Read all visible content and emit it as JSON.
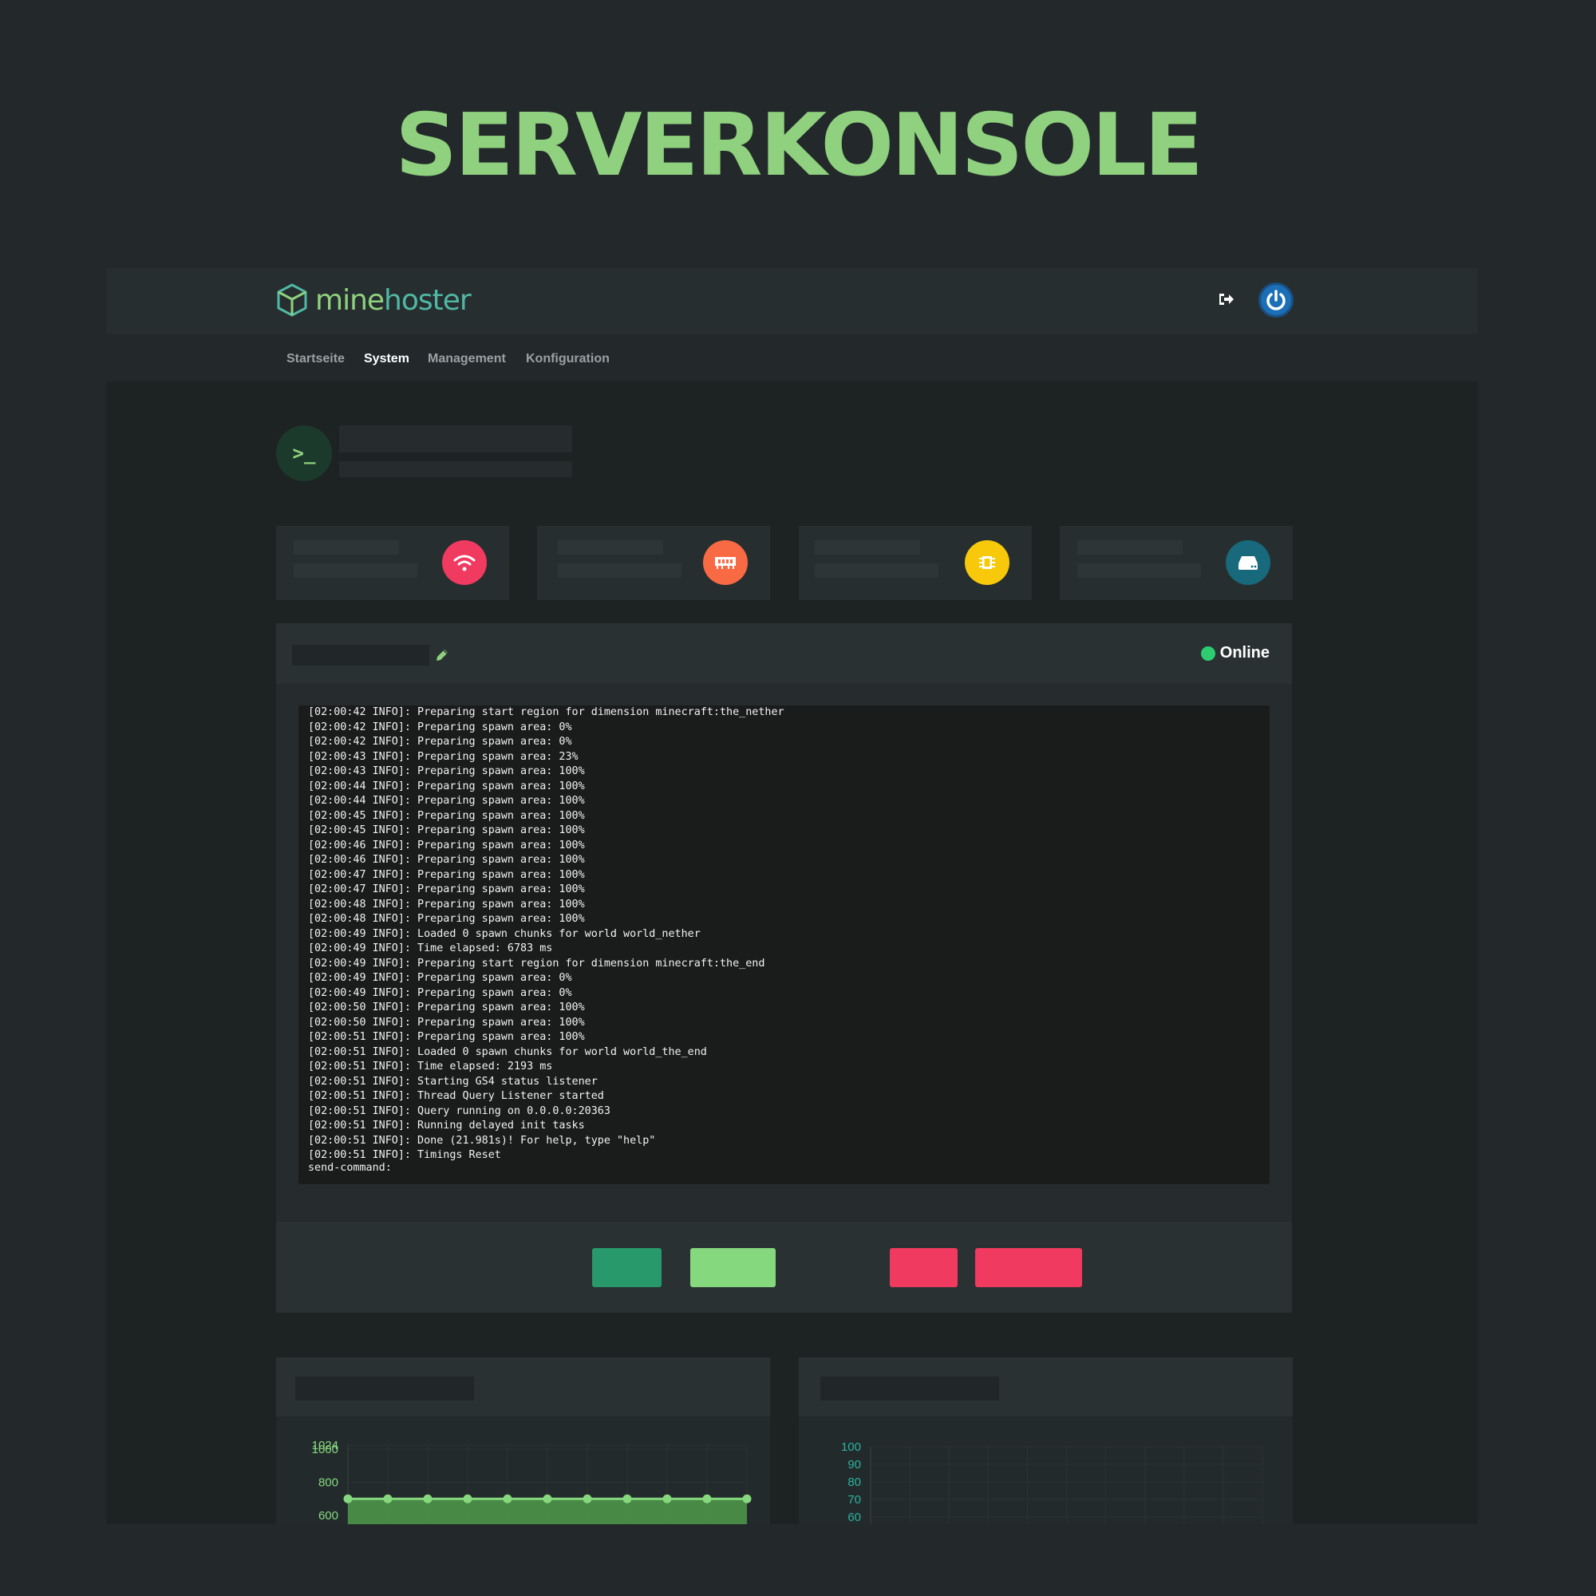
{
  "headline": "SERVERKONSOLE",
  "brand": {
    "part1": "mine",
    "part2": "hoster"
  },
  "header": {
    "logout_icon": "sign-out-icon",
    "power_icon": "power-icon"
  },
  "nav": [
    {
      "label": "Startseite",
      "active": false
    },
    {
      "label": "System",
      "active": true
    },
    {
      "label": "Management",
      "active": false
    },
    {
      "label": "Konfiguration",
      "active": false
    }
  ],
  "stats": [
    {
      "icon": "wifi-icon",
      "color": "#f03a5f"
    },
    {
      "icon": "memory-icon",
      "color": "#f86a43"
    },
    {
      "icon": "cpu-icon",
      "color": "#f7c90a"
    },
    {
      "icon": "hdd-icon",
      "color": "#17697b"
    }
  ],
  "console": {
    "status": "Online",
    "prompt": "send-command:",
    "lines": [
      "[02:00:42 INFO]: Preparing start region for dimension minecraft:the_nether",
      "[02:00:42 INFO]: Preparing spawn area: 0%",
      "[02:00:42 INFO]: Preparing spawn area: 0%",
      "[02:00:43 INFO]: Preparing spawn area: 23%",
      "[02:00:43 INFO]: Preparing spawn area: 100%",
      "[02:00:44 INFO]: Preparing spawn area: 100%",
      "[02:00:44 INFO]: Preparing spawn area: 100%",
      "[02:00:45 INFO]: Preparing spawn area: 100%",
      "[02:00:45 INFO]: Preparing spawn area: 100%",
      "[02:00:46 INFO]: Preparing spawn area: 100%",
      "[02:00:46 INFO]: Preparing spawn area: 100%",
      "[02:00:47 INFO]: Preparing spawn area: 100%",
      "[02:00:47 INFO]: Preparing spawn area: 100%",
      "[02:00:48 INFO]: Preparing spawn area: 100%",
      "[02:00:48 INFO]: Preparing spawn area: 100%",
      "[02:00:49 INFO]: Loaded 0 spawn chunks for world world_nether",
      "[02:00:49 INFO]: Time elapsed: 6783 ms",
      "[02:00:49 INFO]: Preparing start region for dimension minecraft:the_end",
      "[02:00:49 INFO]: Preparing spawn area: 0%",
      "[02:00:49 INFO]: Preparing spawn area: 0%",
      "[02:00:50 INFO]: Preparing spawn area: 100%",
      "[02:00:50 INFO]: Preparing spawn area: 100%",
      "[02:00:51 INFO]: Preparing spawn area: 100%",
      "[02:00:51 INFO]: Loaded 0 spawn chunks for world world_the_end",
      "[02:00:51 INFO]: Time elapsed: 2193 ms",
      "[02:00:51 INFO]: Starting GS4 status listener",
      "[02:00:51 INFO]: Thread Query Listener started",
      "[02:00:51 INFO]: Query running on 0.0.0.0:20363",
      "[02:00:51 INFO]: Running delayed init tasks",
      "[02:00:51 INFO]: Done (21.981s)! For help, type \"help\"",
      "[02:00:51 INFO]: Timings Reset"
    ]
  },
  "buttons": [
    {
      "color": "#27996a"
    },
    {
      "color": "#86d87e"
    },
    {
      "color": "#f03a5f"
    },
    {
      "color": "#f03a5f"
    }
  ],
  "chart_data": [
    {
      "type": "line",
      "yticks": [
        "1024",
        "1000",
        "800",
        "600"
      ],
      "x": [
        1,
        2,
        3,
        4,
        5,
        6,
        7,
        8,
        9,
        10,
        11
      ],
      "values": [
        700,
        700,
        700,
        700,
        700,
        700,
        700,
        700,
        700,
        700,
        700
      ],
      "ylim": [
        600,
        1024
      ],
      "color": "#86d87e",
      "grid": true
    },
    {
      "type": "line",
      "yticks": [
        "100",
        "90",
        "80",
        "70",
        "60"
      ],
      "values": [],
      "ylim": [
        60,
        100
      ],
      "color": "#2bb3a0",
      "grid": true
    }
  ]
}
